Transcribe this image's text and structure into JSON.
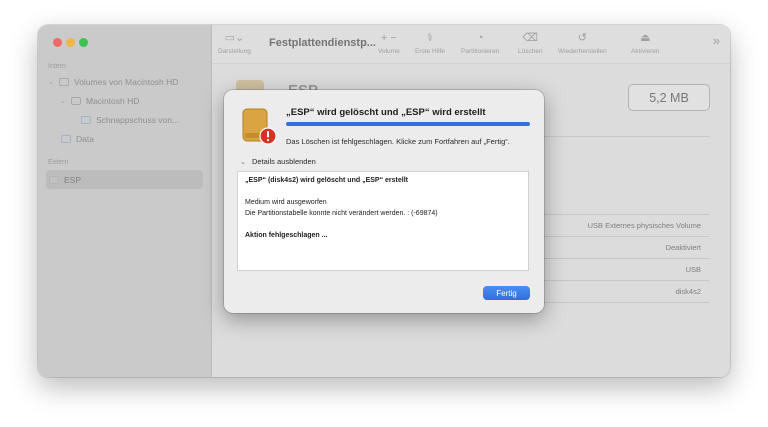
{
  "window": {
    "title": "Festplattendienstp...",
    "toolbar": {
      "buttons": [
        {
          "label": "Darstellung",
          "icon": "sidebar-icon"
        },
        {
          "label": "Volume",
          "icon": "plus-minus-icon"
        },
        {
          "label": "Erste Hilfe",
          "icon": "stethoscope-icon"
        },
        {
          "label": "Partitionieren",
          "icon": "pie-icon"
        },
        {
          "label": "Löschen",
          "icon": "erase-icon"
        },
        {
          "label": "Wiederherstellen",
          "icon": "restore-icon"
        },
        {
          "label": "Aktivieren",
          "icon": "mount-icon"
        }
      ],
      "more": "»"
    }
  },
  "sidebar": {
    "section_internal": "Intern",
    "section_external": "Extern",
    "items": [
      {
        "label": "Volumes von Macintosh HD"
      },
      {
        "label": "Macintosh HD"
      },
      {
        "label": "Schnappschuss von..."
      },
      {
        "label": "Data"
      },
      {
        "label": "ESP"
      }
    ]
  },
  "content": {
    "volume_name": "ESP",
    "size": "5,2 MB",
    "info_rows": [
      "USB Externes physisches Volume",
      "Deaktiviert",
      "USB",
      "disk4s2"
    ]
  },
  "dialog": {
    "title": "„ESP“ wird gelöscht und „ESP“ wird erstellt",
    "progress": 1.0,
    "message": "Das Löschen ist fehlgeschlagen. Klicke zum Fortfahren auf „Fertig“.",
    "details_toggle": "Details ausblenden",
    "log": [
      {
        "text": "„ESP“ (disk4s2) wird gelöscht und „ESP“ erstellt",
        "bold": true
      },
      {
        "text": "",
        "bold": false
      },
      {
        "text": "Medium wird ausgeworfen",
        "bold": false
      },
      {
        "text": "Die Partitionstabelle konnte nicht verändert werden. : (-69874)",
        "bold": false
      },
      {
        "text": "",
        "bold": false
      },
      {
        "text": "Aktion fehlgeschlagen ...",
        "bold": true
      }
    ],
    "done_button": "Fertig"
  },
  "colors": {
    "accent": "#2f6fde",
    "error_badge": "#d93025",
    "drive_color": "#d9a441"
  }
}
